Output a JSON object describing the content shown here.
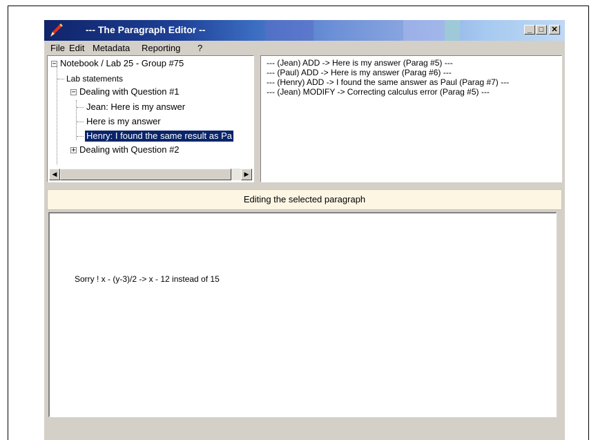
{
  "window": {
    "title": "--- The Paragraph Editor --",
    "minimize_glyph": "_",
    "maximize_glyph": "□",
    "close_glyph": "✕"
  },
  "menu": [
    "File",
    "Edit",
    "Metadata",
    "Reporting",
    "?"
  ],
  "tree": {
    "root": "Notebook / Lab 25 - Group #75",
    "lab_statements": "Lab statements",
    "question1": "Dealing with Question #1",
    "q1_children": [
      "Jean: Here is my answer",
      "Here is my answer",
      "Henry: I found the same result as Pa"
    ],
    "question2": "Dealing with Question #2",
    "expand_minus": "−",
    "expand_plus": "+"
  },
  "log": [
    "--- (Jean)  ADD -> Here is my answer (Parag #5) ---",
    "--- (Paul)  ADD -> Here is my answer (Parag #6) ---",
    "--- (Henry)  ADD -> I found the same answer as Paul (Parag #7) ---",
    "--- (Jean)  MODIFY -> Correcting calculus error (Parag #5) ---"
  ],
  "editor": {
    "header": "Editing the selected paragraph",
    "text": "Sorry ! x - (y-3)/2 -> x - 12 instead of 15"
  },
  "scroll": {
    "left_arrow": "◀",
    "right_arrow": "▶"
  },
  "icons": {
    "app": "pen-icon"
  }
}
